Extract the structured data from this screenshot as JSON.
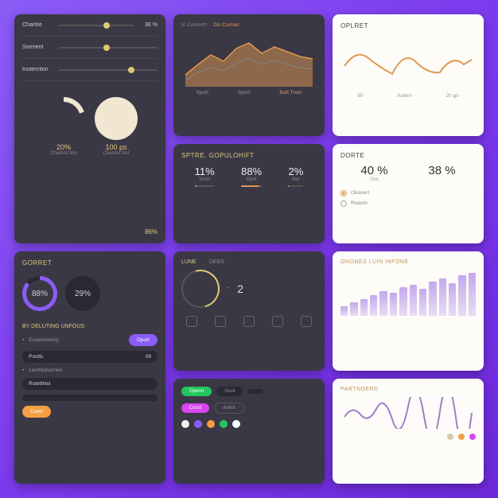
{
  "card1": {
    "sliders": [
      {
        "label": "Chartire",
        "value": "38 %"
      },
      {
        "label": "Sorment",
        "value": ""
      },
      {
        "label": "Instennton",
        "value": ""
      }
    ],
    "donuts": [
      {
        "value": "20%",
        "sub": "Chemist Net"
      },
      {
        "value": "100 ps",
        "sub": "Chemist Net"
      }
    ],
    "footer": "86%"
  },
  "card2": {
    "tabs": [
      "In Comorth",
      "Dis Cortset"
    ],
    "legend": [
      "Sport",
      "Sport",
      "Bott Trom"
    ]
  },
  "card3": {
    "title": "OPLRET",
    "legend": [
      "80",
      "Astern",
      "20 go"
    ]
  },
  "card4": {
    "title": "SPTRE. GOPULOHIFT",
    "items": [
      {
        "num": "11%",
        "lbl": "Soret"
      },
      {
        "num": "88%",
        "lbl": "Opet"
      },
      {
        "num": "2%",
        "lbl": "Net"
      }
    ]
  },
  "card5": {
    "title": "DORTE",
    "items": [
      {
        "num": "40 %",
        "lbl": "Stat"
      },
      {
        "num": "38 %",
        "lbl": ""
      }
    ],
    "radios": [
      "Obovert",
      "Roaom"
    ]
  },
  "card6": {
    "title": "GORRET",
    "circles": [
      "88%",
      "29%"
    ],
    "section": "BY DELUTING UNFOUS",
    "items": [
      "Essenesenry",
      "Pootts",
      "Lamthonornen",
      "Rotetthist"
    ],
    "pill_val": "09",
    "buttons": [
      "Oport",
      "Coert"
    ]
  },
  "card7": {
    "tabs": [
      "LUNE",
      "DEBS"
    ],
    "ring_val": "",
    "big": "2",
    "icons_count": 5
  },
  "card8": {
    "title": "ONONES LUIN INFONE"
  },
  "card9": {
    "chips_row1": [
      "Opeort",
      "Goot"
    ],
    "chips_row2": [
      "Cosst",
      "Anest"
    ],
    "dot_colors": [
      "#f5f0e8",
      "#8b5cf6",
      "#f59e42",
      "#22c55e",
      "#fff"
    ]
  },
  "card10": {
    "title": "PARTNOERD",
    "dot_colors": [
      "#d8c8b0",
      "#f59e42",
      "#d946ef"
    ]
  },
  "chart_data": [
    {
      "type": "area",
      "card": "card2",
      "x": [
        0,
        1,
        2,
        3,
        4,
        5,
        6,
        7,
        8,
        9
      ],
      "series": [
        {
          "name": "Sport",
          "values": [
            20,
            35,
            50,
            40,
            60,
            70,
            55,
            65,
            58,
            50
          ]
        },
        {
          "name": "Bott Trom",
          "values": [
            10,
            22,
            30,
            25,
            38,
            45,
            35,
            42,
            36,
            30
          ]
        }
      ],
      "ylim": [
        0,
        80
      ]
    },
    {
      "type": "line",
      "card": "card3",
      "title": "OPLRET",
      "x": [
        0,
        1,
        2,
        3,
        4,
        5,
        6,
        7
      ],
      "values": [
        40,
        60,
        30,
        55,
        25,
        50,
        35,
        45
      ],
      "ylim": [
        0,
        80
      ]
    },
    {
      "type": "bar",
      "card": "card8",
      "title": "ONONES LUIN INFONE",
      "categories": [
        "",
        "",
        "",
        "",
        "",
        "",
        "",
        "",
        "",
        "",
        "",
        "",
        "",
        ""
      ],
      "values": [
        15,
        22,
        28,
        35,
        42,
        38,
        48,
        52,
        45,
        58,
        62,
        55,
        68,
        72
      ],
      "ylim": [
        0,
        80
      ]
    },
    {
      "type": "line",
      "card": "card10",
      "title": "PARTNOERD",
      "x": [
        0,
        1,
        2,
        3,
        4,
        5,
        6,
        7,
        8,
        9,
        10,
        11
      ],
      "values": [
        30,
        45,
        25,
        50,
        35,
        55,
        40,
        48,
        32,
        42,
        28,
        38
      ],
      "ylim": [
        0,
        60
      ]
    }
  ]
}
